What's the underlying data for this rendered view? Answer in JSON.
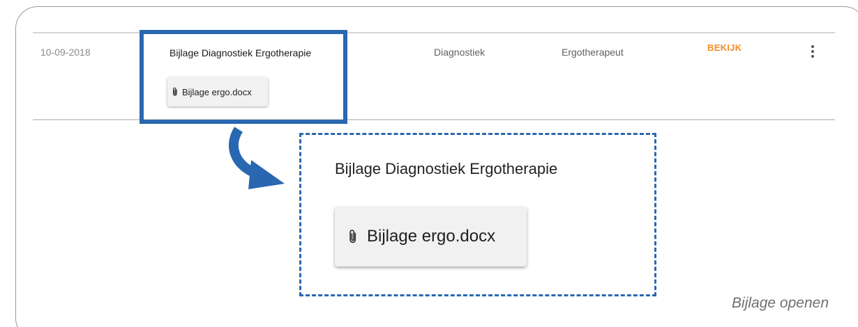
{
  "row": {
    "date": "10-09-2018",
    "title": "Bijlage Diagnostiek Ergotherapie",
    "attachment_label": "Bijlage ergo.docx",
    "category": "Diagnostiek",
    "role": "Ergotherapeut",
    "view_label": "BEKIJK"
  },
  "zoom": {
    "title": "Bijlage Diagnostiek Ergotherapie",
    "attachment_label": "Bijlage ergo.docx"
  },
  "caption": "Bijlage openen",
  "icons": {
    "attachment": "paperclip-icon",
    "more": "more-vertical-icon",
    "arrow": "curved-arrow-icon"
  },
  "colors": {
    "accent_blue": "#2a67b1",
    "view_orange": "#f28c28",
    "chip_bg": "#f2f2f2",
    "divider": "#d5d5d5"
  }
}
